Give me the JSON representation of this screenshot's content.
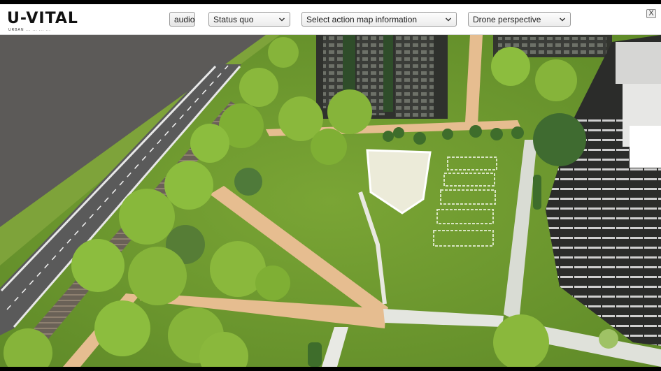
{
  "app": {
    "logo_text": "U-VITAL",
    "logo_subtitle": "URBAN ... ... ... ..."
  },
  "toolbar": {
    "audio_label": "audio",
    "scenario_select": {
      "selected": "Status quo"
    },
    "action_map_select": {
      "selected": "Select action map information"
    },
    "perspective_select": {
      "selected": "Drone perspective"
    },
    "close_label": "X"
  },
  "icons": {
    "dropdown": "chevron-down-icon",
    "close": "close-icon"
  },
  "colors": {
    "grass": "#6e9a2e",
    "path": "#e9bf93",
    "road": "#5a5a5a",
    "building": "#2e2f2c",
    "tree": "#86b43a"
  }
}
